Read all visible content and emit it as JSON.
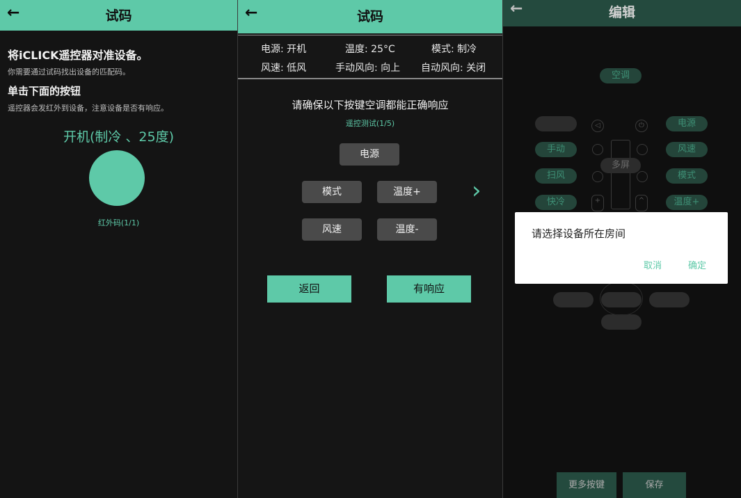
{
  "panel1": {
    "back_icon": "←",
    "title": "试码",
    "heading1": "将iCLICK遥控器对准设备。",
    "sub1": "你需要通过试码找出设备的匹配码。",
    "heading2": "单击下面的按钮",
    "sub2": "遥控器会发红外到设备，注意设备是否有响应。",
    "command": "开机(制冷 、25度)",
    "code_progress": "红外码(1/1)"
  },
  "panel2": {
    "back_icon": "←",
    "title": "试码",
    "status": {
      "power": "电源: 开机",
      "temp": "温度: 25°C",
      "mode": "模式: 制冷",
      "fan": "风速: 低风",
      "manual_swing": "手动风向: 向上",
      "auto_swing": "自动风向: 关闭"
    },
    "instruction": "请确保以下按键空调都能正确响应",
    "progress": "遥控测试(1/5)",
    "keys": {
      "power": "电源",
      "mode": "模式",
      "temp_up": "温度+",
      "fan": "风速",
      "temp_down": "温度-"
    },
    "next_icon": "›",
    "back_button": "返回",
    "respond_button": "有响应"
  },
  "panel3": {
    "back_icon": "←",
    "title": "编辑",
    "device_tag": "空调",
    "buttons": {
      "power": "电源",
      "manual": "手动",
      "fan": "风速",
      "swing": "扫风",
      "multi": "多屏",
      "mode": "模式",
      "fast_cool": "快冷",
      "temp_up": "温度+"
    },
    "dialog": {
      "title": "请选择设备所在房间",
      "cancel": "取消",
      "confirm": "确定"
    },
    "more_buttons": "更多按键",
    "save": "保存"
  },
  "colors": {
    "accent": "#5ec9a8",
    "background": "#141414",
    "key_button": "#4a4a4a"
  }
}
